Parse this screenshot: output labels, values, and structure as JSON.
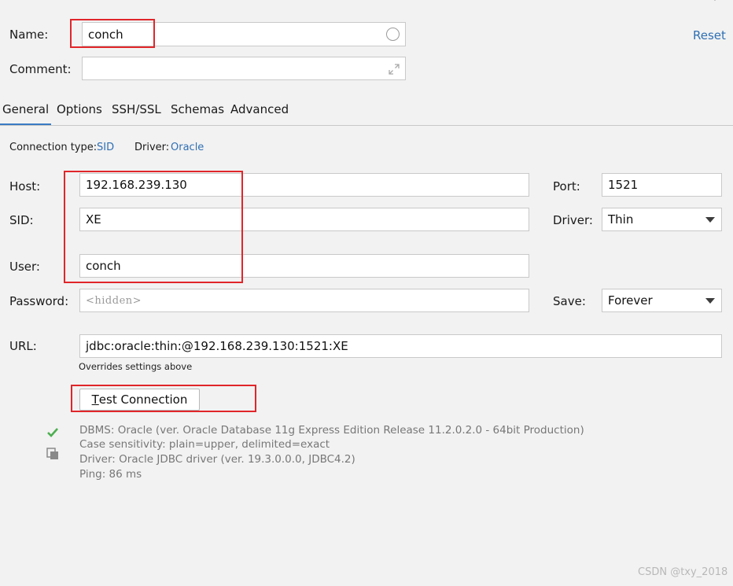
{
  "window": {
    "close_icon": "close-icon"
  },
  "header": {
    "name_label": "Name:",
    "name_value": "conch",
    "comment_label": "Comment:",
    "comment_value": "",
    "reset_label": "Reset"
  },
  "tabs": [
    {
      "label": "General",
      "active": true
    },
    {
      "label": "Options",
      "active": false
    },
    {
      "label": "SSH/SSL",
      "active": false
    },
    {
      "label": "Schemas",
      "active": false
    },
    {
      "label": "Advanced",
      "active": false
    }
  ],
  "general": {
    "connection_type_label": "Connection type:",
    "connection_type_value": "SID",
    "driver_label": "Driver:",
    "driver_value": "Oracle",
    "host_label": "Host:",
    "host_value": "192.168.239.130",
    "port_label": "Port:",
    "port_value": "1521",
    "sid_label": "SID:",
    "sid_value": "XE",
    "driver_select_label": "Driver:",
    "driver_select_value": "Thin",
    "user_label": "User:",
    "user_value": "conch",
    "password_label": "Password:",
    "password_placeholder": "<hidden>",
    "save_label": "Save:",
    "save_value": "Forever",
    "url_label": "URL:",
    "url_value": "jdbc:oracle:thin:@192.168.239.130:1521:XE",
    "url_hint": "Overrides settings above",
    "test_button_mnemonic": "T",
    "test_button_rest": "est Connection"
  },
  "result": {
    "status": "success",
    "lines": [
      "DBMS: Oracle (ver. Oracle Database 11g Express Edition Release 11.2.0.2.0 - 64bit Production)",
      "Case sensitivity: plain=upper, delimited=exact",
      "Driver: Oracle JDBC driver (ver. 19.3.0.0.0, JDBC4.2)",
      "Ping: 86 ms"
    ]
  },
  "watermark": "CSDN @txy_2018",
  "colors": {
    "accent": "#2f6fb3",
    "highlight": "#e0262a",
    "success": "#4caf50"
  }
}
